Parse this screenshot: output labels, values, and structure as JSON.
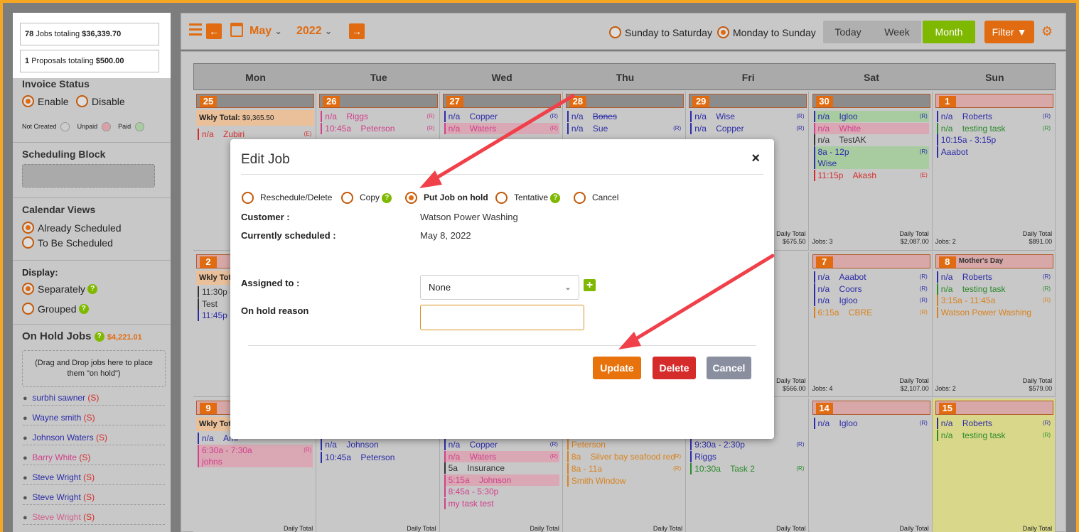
{
  "totals": {
    "jobs": {
      "count": "78",
      "mid": "Jobs totaling",
      "amount": "$36,339.70"
    },
    "proposals": {
      "count": "1",
      "mid": "Proposals totaling",
      "amount": "$500.00"
    }
  },
  "sidebar": {
    "invoice_status": {
      "title": "Invoice Status",
      "enable": "Enable",
      "disable": "Disable",
      "not_created": "Not Created",
      "unpaid": "Unpaid",
      "paid": "Paid"
    },
    "scheduling_block": {
      "title": "Scheduling Block"
    },
    "calendar_views": {
      "title": "Calendar Views",
      "already": "Already Scheduled",
      "to_be": "To Be Scheduled"
    },
    "display": {
      "title": "Display:",
      "separately": "Separately",
      "grouped": "Grouped"
    },
    "on_hold": {
      "title": "On Hold Jobs",
      "amount": "$4,221.01",
      "drop_hint": "(Drag and Drop jobs here to place them \"on hold\")"
    },
    "people": [
      {
        "name": "surbhi sawner",
        "tag": "(S)",
        "color": "#2c2ca8"
      },
      {
        "name": "Wayne smith",
        "tag": "(S)",
        "color": "#2c2ca8"
      },
      {
        "name": "Johnson Waters",
        "tag": "(S)",
        "color": "#2c2ca8"
      },
      {
        "name": "Barry White",
        "tag": "(S)",
        "color": "#d0408a"
      },
      {
        "name": "Steve Wright",
        "tag": "(S)",
        "color": "#2c2ca8"
      },
      {
        "name": "Steve Wright",
        "tag": "(S)",
        "color": "#2c2ca8"
      },
      {
        "name": "Steve Wright",
        "tag": "(S)",
        "color": "#d0608a"
      }
    ]
  },
  "topbar": {
    "month": "May",
    "year": "2022",
    "sun_sat": "Sunday to Saturday",
    "mon_sun": "Monday to Sunday",
    "today": "Today",
    "week": "Week",
    "month_btn": "Month",
    "filter": "Filter"
  },
  "calendar": {
    "days": [
      "Mon",
      "Tue",
      "Wed",
      "Thu",
      "Fri",
      "Sat",
      "Sun"
    ],
    "week1": {
      "nums": [
        "25",
        "26",
        "27",
        "28",
        "29",
        "30",
        "1"
      ],
      "wkly": {
        "label": "Wkly Total:",
        "amount": "$9,365.50"
      },
      "mon": [
        {
          "t": "n/a",
          "n": "Zubiri",
          "r": "(E)"
        }
      ],
      "tue": [
        {
          "t": "n/a",
          "n": "Riggs",
          "r": "(R)"
        },
        {
          "t": "10:45a",
          "n": "Peterson",
          "r": "(R)"
        }
      ],
      "wed": [
        {
          "t": "n/a",
          "n": "Copper",
          "r": "(R)"
        },
        {
          "t": "n/a",
          "n": "Waters",
          "r": "(R)"
        }
      ],
      "thu": [
        {
          "t": "n/a",
          "n": "Bones",
          "r": ""
        },
        {
          "t": "n/a",
          "n": "Sue",
          "r": "(R)"
        }
      ],
      "fri": [
        {
          "t": "n/a",
          "n": "Wise",
          "r": "(R)"
        },
        {
          "t": "n/a",
          "n": "Copper",
          "r": "(R)"
        }
      ],
      "sat": [
        {
          "t": "n/a",
          "n": "Igloo",
          "r": "(R)"
        },
        {
          "t": "n/a",
          "n": "White",
          "r": ""
        },
        {
          "t": "n/a",
          "n": "TestAK",
          "r": ""
        },
        {
          "t": "8a - 12p",
          "n": "",
          "r": "(R)"
        },
        {
          "t": "Wise",
          "n": "",
          "r": ""
        },
        {
          "t": "11:15p",
          "n": "Akash",
          "r": "(E)"
        }
      ],
      "sun": [
        {
          "t": "n/a",
          "n": "Roberts",
          "r": "(R)"
        },
        {
          "t": "n/a",
          "n": "testing task",
          "r": "(R)"
        },
        {
          "t": "10:15a - 3:15p",
          "n": "",
          "r": ""
        },
        {
          "t": "Aaabot",
          "n": "",
          "r": ""
        }
      ],
      "fri_total": {
        "label": "Daily Total",
        "amount": "$675.50"
      },
      "sat_total": {
        "jobs": "Jobs: 3",
        "label": "Daily Total",
        "amount": "$2,087.00"
      },
      "sun_total": {
        "jobs": "Jobs: 2",
        "label": "Daily Total",
        "amount": "$891.00"
      }
    },
    "week2": {
      "nums": [
        "2",
        "7",
        "8"
      ],
      "sun_label": "Mother's Day",
      "wkly": "Wkly Tota",
      "mon": [
        {
          "t": "11:30p -",
          "n": ""
        },
        {
          "t": "Test",
          "n": ""
        },
        {
          "t": "11:45p",
          "n": ""
        }
      ],
      "sat": [
        {
          "t": "n/a",
          "n": "Aaabot",
          "r": "(R)"
        },
        {
          "t": "n/a",
          "n": "Coors",
          "r": "(R)"
        },
        {
          "t": "n/a",
          "n": "Igloo",
          "r": "(R)"
        },
        {
          "t": "6:15a",
          "n": "CBRE",
          "r": "(R)"
        }
      ],
      "sun": [
        {
          "t": "n/a",
          "n": "Roberts",
          "r": "(R)"
        },
        {
          "t": "n/a",
          "n": "testing task",
          "r": "(R)"
        },
        {
          "t": "3:15a - 11:45a",
          "n": "",
          "r": "(R)"
        },
        {
          "t": "Watson Power Washing",
          "n": "",
          "r": ""
        }
      ],
      "fri_total": {
        "label": "Daily Total",
        "amount": "$566.00"
      },
      "sat_total": {
        "jobs": "Jobs: 4",
        "label": "Daily Total",
        "amount": "$2,107.00"
      },
      "sun_total": {
        "jobs": "Jobs: 2",
        "label": "Daily Total",
        "amount": "$579.00"
      }
    },
    "week3": {
      "nums": [
        "9",
        "14",
        "15"
      ],
      "wkly": "Wkly Tota",
      "mon": [
        {
          "t": "n/a",
          "n": "Ami",
          "r": ""
        },
        {
          "t": "6:30a - 7:30a",
          "n": "",
          "r": "(R)"
        },
        {
          "t": "johns",
          "n": "",
          "r": ""
        }
      ],
      "tue": [
        {
          "t": "n/a",
          "n": "Johnson",
          "r": ""
        },
        {
          "t": "10:45a",
          "n": "Peterson",
          "r": ""
        }
      ],
      "wed": [
        {
          "t": "n/a",
          "n": "Copper",
          "r": "(R)"
        },
        {
          "t": "n/a",
          "n": "Waters",
          "r": "(R)"
        },
        {
          "t": "5a",
          "n": "Insurance",
          "r": ""
        },
        {
          "t": "5:15a",
          "n": "Johnson",
          "r": ""
        },
        {
          "t": "8:45a - 5:30p",
          "n": "",
          "r": ""
        },
        {
          "t": "my task test",
          "n": "",
          "r": ""
        }
      ],
      "thu": [
        {
          "t": "Peterson",
          "n": "",
          "r": ""
        },
        {
          "t": "8a",
          "n": "Silver bay seafood red",
          "r": "(R)"
        },
        {
          "t": "8a - 11a",
          "n": "",
          "r": "(R)"
        },
        {
          "t": "Smith Window",
          "n": "",
          "r": ""
        }
      ],
      "fri": [
        {
          "t": "9:30a - 2:30p",
          "n": "",
          "r": "(R)"
        },
        {
          "t": "Riggs",
          "n": "",
          "r": ""
        },
        {
          "t": "10:30a",
          "n": "Task 2",
          "r": "(R)"
        }
      ],
      "sat": [
        {
          "t": "n/a",
          "n": "Igloo",
          "r": "(R)"
        }
      ],
      "sun": [
        {
          "t": "n/a",
          "n": "Roberts",
          "r": "(R)"
        },
        {
          "t": "n/a",
          "n": "testing task",
          "r": "(R)"
        }
      ],
      "daily": "Daily Total"
    }
  },
  "modal": {
    "title": "Edit Job",
    "close": "×",
    "options": [
      "Reschedule/Delete",
      "Copy",
      "Put Job on hold",
      "Tentative",
      "Cancel"
    ],
    "customer_label": "Customer :",
    "customer_value": "Watson Power Washing",
    "scheduled_label": "Currently scheduled :",
    "scheduled_value": "May 8, 2022",
    "assigned_label": "Assigned to :",
    "assigned_value": "None",
    "reason_label": "On hold reason",
    "reason_value": "",
    "update": "Update",
    "delete": "Delete",
    "cancel": "Cancel"
  },
  "colors": {
    "orange": "#e06b10",
    "green": "#7fb800",
    "red": "#d62b2b",
    "gray": "#8a8fa0"
  }
}
